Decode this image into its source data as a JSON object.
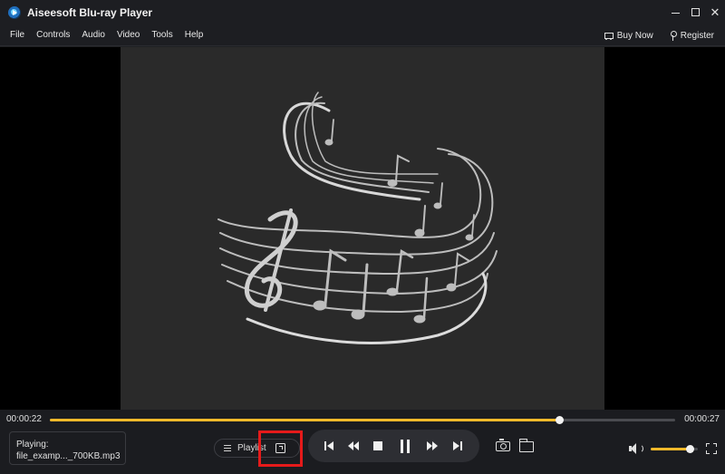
{
  "window": {
    "title": "Aiseesoft Blu-ray Player"
  },
  "menu": {
    "items": [
      {
        "label": "File"
      },
      {
        "label": "Controls"
      },
      {
        "label": "Audio"
      },
      {
        "label": "Video"
      },
      {
        "label": "Tools"
      },
      {
        "label": "Help"
      }
    ],
    "buy_now": "Buy Now",
    "register": "Register"
  },
  "playback": {
    "current_time": "00:00:22",
    "total_time": "00:00:27",
    "progress": 0.815,
    "volume": 0.83
  },
  "now_playing": {
    "label": "Playing:",
    "file": "file_examp..._700KB.mp3"
  },
  "playlist": {
    "label": "Playlist"
  },
  "colors": {
    "accent": "#f0b92a",
    "highlight": "#e51a1a",
    "background": "#1b1c20"
  }
}
